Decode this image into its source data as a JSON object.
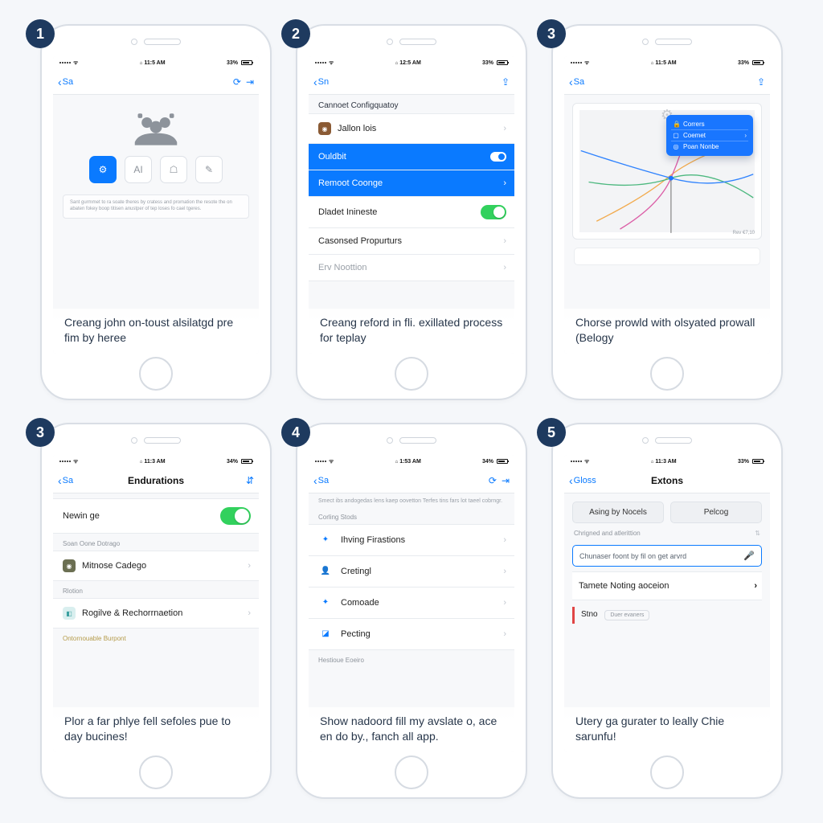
{
  "colors": {
    "accent": "#0a7aff",
    "badge": "#1e3a5f",
    "toggle_on": "#32d15d",
    "popup": "#1976ff",
    "danger": "#e04545"
  },
  "steps": [
    {
      "badge": "1",
      "status": {
        "time": "11:5 AM",
        "pct": "33%"
      },
      "nav": {
        "back": "Sa"
      },
      "buttons": [
        "AI",
        "shield",
        "edit"
      ],
      "tiny_text": "Sant gurmmet to ra soate theres by cratess and promation the resote the on abaten fokey boop titisen anustper of tep loses fo cael tgeres.",
      "caption": "Creang john on-toust alsilatgd pre fim by heree"
    },
    {
      "badge": "2",
      "status": {
        "time": "12:5 AM",
        "pct": "33%"
      },
      "nav": {
        "back": "Sn"
      },
      "header": "Cannoet Configquatoy",
      "rows": [
        {
          "label": "Jallon lois",
          "type": "disclosure",
          "icon_bg": "#8a5a34"
        },
        {
          "label": "Ouldbit",
          "type": "radio",
          "selected": true
        },
        {
          "label": "Remoot Coonge",
          "type": "disclosure",
          "selected": true
        },
        {
          "label": "Dladet Inineste",
          "type": "toggle_on"
        },
        {
          "label": "Casonsed Propurturs",
          "type": "disclosure"
        },
        {
          "label": "Erv Noottion",
          "type": "disclosure",
          "dim": true
        }
      ],
      "caption": "Creang reford in fli. exillated process for teplay"
    },
    {
      "badge": "3",
      "status": {
        "time": "11:5 AM",
        "pct": "33%"
      },
      "nav": {
        "back": "Sa"
      },
      "popup": [
        {
          "icon": "lock",
          "label": "Corrers"
        },
        {
          "icon": "box",
          "label": "Coemet",
          "chev": true
        },
        {
          "icon": "target",
          "label": "Poan Nonbe"
        }
      ],
      "map_footnote": "Rev €7,10",
      "caption": "Chorse prowld with olsyated prowall (Belogy"
    },
    {
      "badge": "3",
      "status": {
        "time": "11:3 AM",
        "pct": "34%"
      },
      "nav": {
        "back": "Sa",
        "title": "Endurations"
      },
      "rows": [
        {
          "label": "Newin ge",
          "type": "toggle_on_big"
        }
      ],
      "sections": [
        {
          "header": "Soan Oone Dotrago",
          "rows": [
            {
              "label": "Mitnose Cadego",
              "type": "disclosure",
              "icon_bg": "#6b6f52"
            }
          ]
        },
        {
          "header": "Rlotion",
          "rows": [
            {
              "label": "Rogilve & Rechorrnaetion",
              "type": "disclosure",
              "icon_bg": "#3aa0a0"
            }
          ]
        }
      ],
      "footer_header": "Ontornouable Burpont",
      "caption": "Plor a far phlye fell sefoles pue to day bucines!"
    },
    {
      "badge": "4",
      "status": {
        "time": "1:53 AM",
        "pct": "34%"
      },
      "nav": {
        "back": "Sa"
      },
      "note": "Smect ibs andogedas lens kaep oovetton Terfes tins fars lot taeel cobrngr.",
      "header": "Corling Stods",
      "rows": [
        {
          "label": "Ihving Firastions",
          "type": "disclosure",
          "icon_color": "#0a7aff",
          "icon_glyph": "✦"
        },
        {
          "label": "Cretingl",
          "type": "disclosure",
          "icon_color": "#0a7aff",
          "icon_glyph": "👤"
        },
        {
          "label": "Comoade",
          "type": "disclosure",
          "icon_color": "#0a7aff",
          "icon_glyph": "✦"
        },
        {
          "label": "Pecting",
          "type": "disclosure",
          "icon_color": "#0a7aff",
          "icon_glyph": "◪"
        }
      ],
      "footer_header": "Hestioue Eoeiro",
      "caption": "Show nadoord fill my avslate o, ace en do by., fanch all app."
    },
    {
      "badge": "5",
      "status": {
        "time": "11:3 AM",
        "pct": "33%"
      },
      "nav": {
        "back": "Gloss",
        "title": "Extons"
      },
      "pills": [
        "Asing by Nocels",
        "Pelcog"
      ],
      "section_header": "Chrigned and atlerittion",
      "search_placeholder": "Chunaser foont by fil on get arvrd",
      "row_label": "Tamete Noting aoceion",
      "red_block": {
        "title": "Stno",
        "mini": "Duer evaners"
      },
      "caption": "Utery ga gurater to leally Chie sarunfu!"
    }
  ]
}
